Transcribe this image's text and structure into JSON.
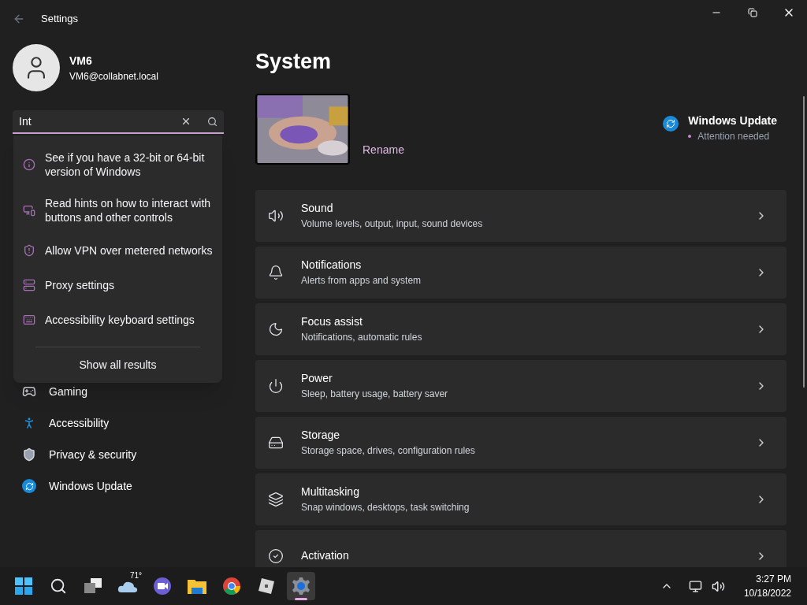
{
  "window": {
    "title": "Settings"
  },
  "account": {
    "name": "VM6",
    "email": "VM6@collabnet.local"
  },
  "search": {
    "value": "Int",
    "results": [
      {
        "kind": "info",
        "text": "See if you have a 32-bit or 64-bit version of Windows"
      },
      {
        "kind": "hint",
        "text": "Read hints on how to interact with buttons and other controls"
      },
      {
        "kind": "shield",
        "text": "Allow VPN over metered networks"
      },
      {
        "kind": "proxy",
        "text": "Proxy settings"
      },
      {
        "kind": "keyboard",
        "text": "Accessibility keyboard settings"
      }
    ],
    "show_all": "Show all results"
  },
  "sidebar": {
    "items": [
      {
        "kind": "gaming",
        "label": "Gaming",
        "selected": false
      },
      {
        "kind": "accessibility",
        "label": "Accessibility",
        "selected": false
      },
      {
        "kind": "privacy",
        "label": "Privacy & security",
        "selected": false
      },
      {
        "kind": "update",
        "label": "Windows Update",
        "selected": false
      }
    ]
  },
  "page": {
    "title": "System",
    "rename": "Rename",
    "update": {
      "title": "Windows Update",
      "status": "Attention needed"
    },
    "cards": [
      {
        "kind": "sound",
        "title": "Sound",
        "subtitle": "Volume levels, output, input, sound devices"
      },
      {
        "kind": "notifications",
        "title": "Notifications",
        "subtitle": "Alerts from apps and system"
      },
      {
        "kind": "focus",
        "title": "Focus assist",
        "subtitle": "Notifications, automatic rules"
      },
      {
        "kind": "power",
        "title": "Power",
        "subtitle": "Sleep, battery usage, battery saver"
      },
      {
        "kind": "storage",
        "title": "Storage",
        "subtitle": "Storage space, drives, configuration rules"
      },
      {
        "kind": "multitasking",
        "title": "Multitasking",
        "subtitle": "Snap windows, desktops, task switching"
      },
      {
        "kind": "activation",
        "title": "Activation"
      }
    ]
  },
  "taskbar": {
    "apps": [
      {
        "kind": "start",
        "selected": false
      },
      {
        "kind": "search",
        "selected": false
      },
      {
        "kind": "taskview",
        "selected": false
      },
      {
        "kind": "weather",
        "badge": "71°",
        "selected": false
      },
      {
        "kind": "chat",
        "selected": false
      },
      {
        "kind": "explorer",
        "selected": false
      },
      {
        "kind": "chrome",
        "selected": false
      },
      {
        "kind": "roblox",
        "selected": false
      },
      {
        "kind": "settings",
        "selected": true
      }
    ],
    "time": "3:27 PM",
    "date": "10/18/2022"
  }
}
